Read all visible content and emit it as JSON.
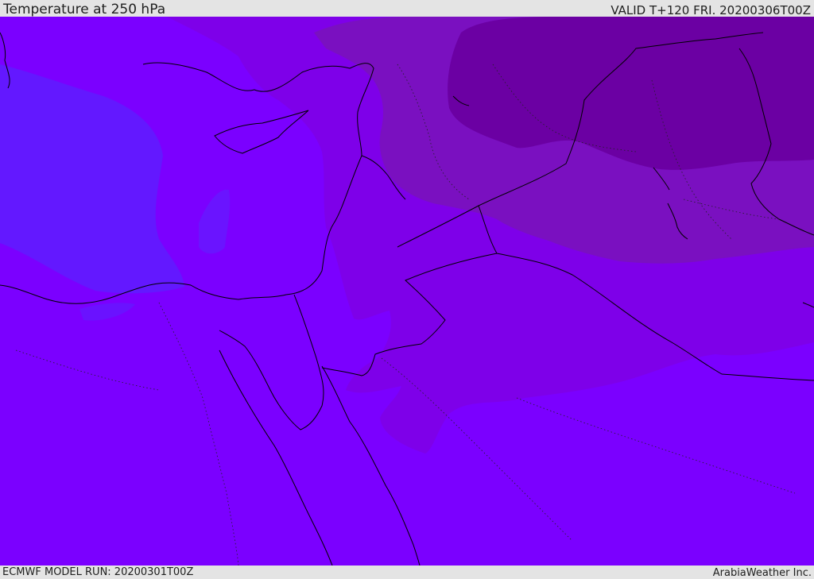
{
  "header": {
    "title": "Temperature at 250 hPa",
    "valid": "VALID T+120 FRI. 20200306T00Z"
  },
  "footer": {
    "model_run": "ECMWF MODEL RUN: 20200301T00Z",
    "credit": "ArabiaWeather Inc."
  },
  "map": {
    "field": "temperature",
    "level": "250 hPa",
    "colors": {
      "base": "#7b00ff",
      "cold_west": "#6318ff",
      "warm_band": "#7e00e9",
      "warmer": "#7a10c0",
      "warmest_northeast": "#6b00a3",
      "coastline": "#000000"
    }
  }
}
